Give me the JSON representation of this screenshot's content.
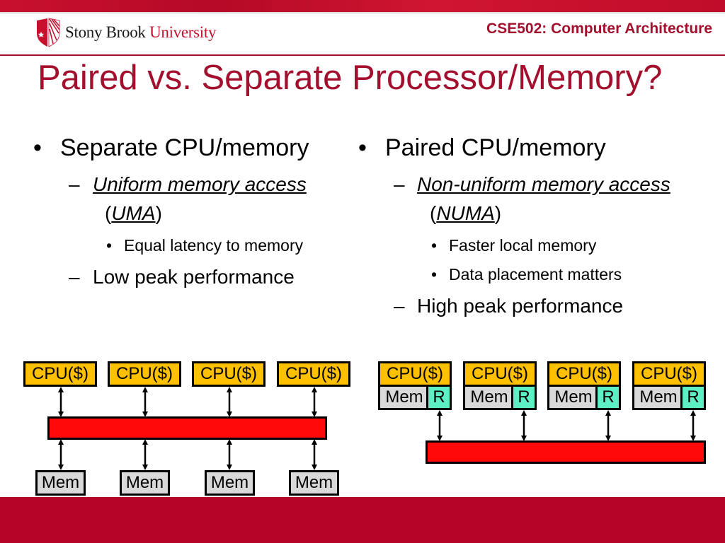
{
  "header": {
    "university_name_part1": "Stony Brook",
    "university_name_part2": "University",
    "course": "CSE502: Computer Architecture"
  },
  "slide": {
    "title": "Paired vs. Separate Processor/Memory?",
    "left": {
      "bullet": "Separate CPU/memory",
      "sub1_italic": "Uniform memory access",
      "sub1_paren_open": "(",
      "sub1_abbrev": "UMA",
      "sub1_paren_close": ")",
      "sub1_points": [
        "Equal latency to memory"
      ],
      "sub2": "Low peak performance"
    },
    "right": {
      "bullet": "Paired CPU/memory",
      "sub1_italic": "Non-uniform memory access",
      "sub1_paren_open": "(",
      "sub1_abbrev": "NUMA",
      "sub1_paren_close": ")",
      "sub1_points": [
        "Faster local memory",
        "Data placement matters"
      ],
      "sub2": "High peak performance"
    },
    "bullet_glyph": "•",
    "dash_glyph": "–"
  },
  "diagram_uma": {
    "cpus": [
      "CPU($)",
      "CPU($)",
      "CPU($)",
      "CPU($)"
    ],
    "mems": [
      "Mem",
      "Mem",
      "Mem",
      "Mem"
    ]
  },
  "diagram_numa": {
    "nodes": [
      {
        "cpu": "CPU($)",
        "mem": "Mem",
        "router": "R"
      },
      {
        "cpu": "CPU($)",
        "mem": "Mem",
        "router": "R"
      },
      {
        "cpu": "CPU($)",
        "mem": "Mem",
        "router": "R"
      },
      {
        "cpu": "CPU($)",
        "mem": "Mem",
        "router": "R"
      }
    ]
  },
  "colors": {
    "brand_red": "#a3102d",
    "cpu": "#ffc000",
    "mem": "#d9d9d9",
    "router": "#5cf0c4",
    "bus": "#fe0a0a"
  }
}
